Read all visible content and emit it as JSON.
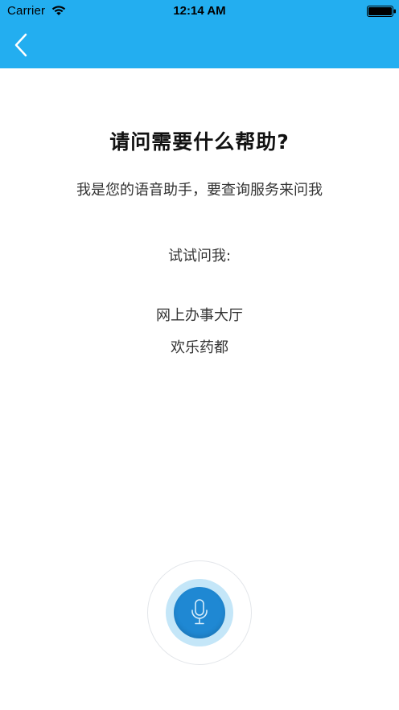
{
  "status_bar": {
    "carrier": "Carrier",
    "time": "12:14 AM",
    "wifi_icon": "wifi-icon",
    "battery_icon": "battery-icon"
  },
  "header": {
    "back_icon": "chevron-left-icon",
    "background_color": "#23aef0"
  },
  "main": {
    "title": "请问需要什么帮助?",
    "subtitle": "我是您的语音助手，要查询服务来问我",
    "try_label": "试试问我:",
    "suggestions": [
      "网上办事大厅",
      "欢乐药都"
    ]
  },
  "voice": {
    "mic_icon": "microphone-icon",
    "button_color": "#1f88d3",
    "halo_color": "#c4e6f8"
  }
}
